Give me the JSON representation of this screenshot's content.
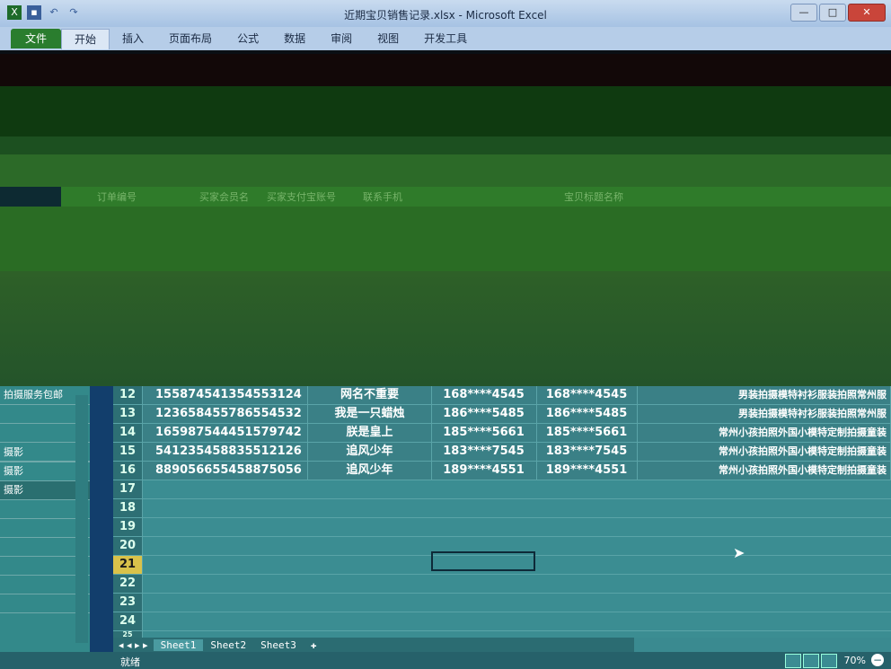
{
  "window": {
    "title": "近期宝贝销售记录.xlsx - Microsoft Excel"
  },
  "ribbon_tabs": [
    "文件",
    "开始",
    "插入",
    "页面布局",
    "公式",
    "数据",
    "审阅",
    "视图",
    "开发工具"
  ],
  "header_labels": [
    "订单编号",
    "买家会员名",
    "买家支付宝账号",
    "联系手机",
    "宝贝标题名称"
  ],
  "left_pane": [
    "拍摄服务包邮",
    "",
    "",
    "",
    "摄影",
    "摄影",
    "摄影",
    "",
    "",
    "",
    "",
    "",
    "",
    ""
  ],
  "rows": [
    {
      "num": "12",
      "order": "155874541354553124",
      "buyer": "网名不重要",
      "alipay": "168****4545",
      "phone": "168****4545",
      "title": "男装拍摄模特衬衫服装拍照常州服"
    },
    {
      "num": "13",
      "order": "123658455786554532",
      "buyer": "我是一只蜡烛",
      "alipay": "186****5485",
      "phone": "186****5485",
      "title": "男装拍摄模特衬衫服装拍照常州服"
    },
    {
      "num": "14",
      "order": "165987544451579742",
      "buyer": "朕是皇上",
      "alipay": "185****5661",
      "phone": "185****5661",
      "title": "常州小孩拍照外国小模特定制拍摄童装"
    },
    {
      "num": "15",
      "order": "541235458835512126",
      "buyer": "追风少年",
      "alipay": "183****7545",
      "phone": "183****7545",
      "title": "常州小孩拍照外国小模特定制拍摄童装"
    },
    {
      "num": "16",
      "order": "889056655458875056",
      "buyer": "追风少年",
      "alipay": "189****4551",
      "phone": "189****4551",
      "title": "常州小孩拍照外国小模特定制拍摄童装"
    }
  ],
  "empty_rows": [
    "17",
    "18",
    "19",
    "20",
    "21",
    "22",
    "23",
    "24",
    "25"
  ],
  "selected_row": "21",
  "sheets": [
    "Sheet1",
    "Sheet2",
    "Sheet3"
  ],
  "status": {
    "ready": "就绪",
    "zoom": "70%"
  }
}
